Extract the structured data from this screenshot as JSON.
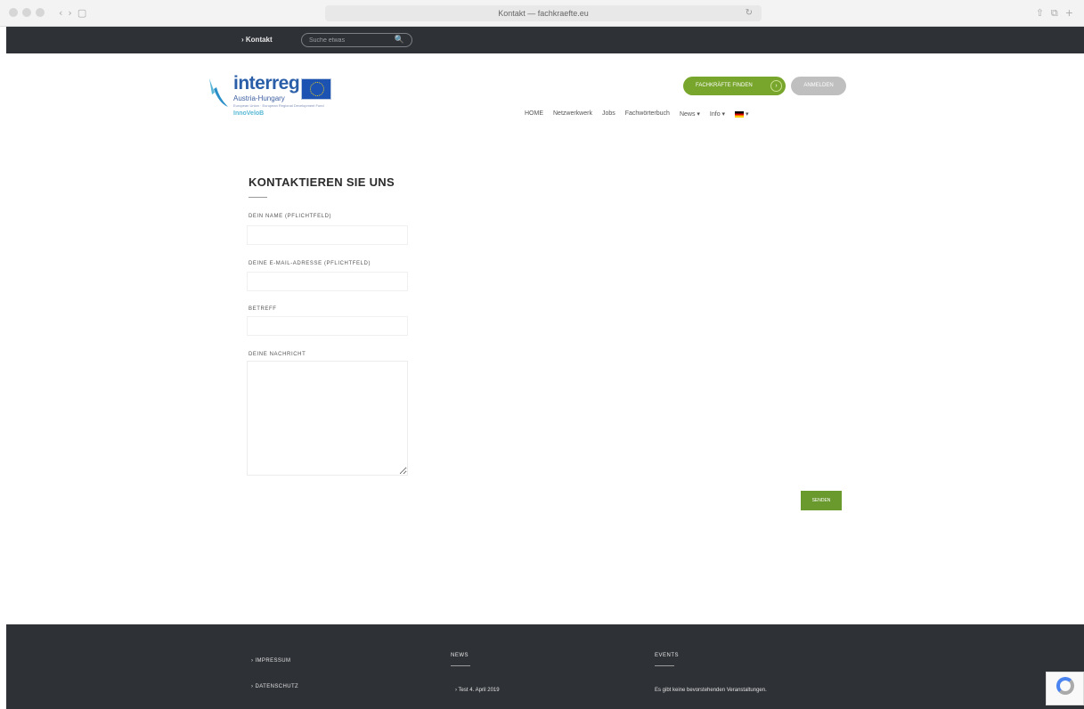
{
  "browser": {
    "address": "Kontakt — fachkraefte.eu",
    "nav_back": "‹",
    "nav_forward": "›",
    "sidebar_icon": "▢",
    "reload_icon": "↻",
    "share_icon": "⇧",
    "tabs_icon": "⧉",
    "newtab_icon": "+"
  },
  "topbar": {
    "kontakt": "› Kontakt",
    "search_placeholder": "Suche etwas",
    "search_icon": "🔍"
  },
  "logo": {
    "word": "interreg",
    "sub": "Austria-Hungary",
    "tiny": "European Union · European Regional Development Fund",
    "project": "InnoVeloB"
  },
  "header": {
    "green_button": "FACHKRÄFTE FINDEN",
    "green_arrow": "›",
    "grey_button": "ANMELDEN"
  },
  "nav": {
    "items": [
      "HOME",
      "Netzwerkwerk",
      "Jobs",
      "Fachwörterbuch",
      "News ▾",
      "Info ▾"
    ],
    "lang_caret": "▾"
  },
  "form": {
    "title": "KONTAKTIEREN SIE UNS",
    "name_label": "DEIN NAME (PFLICHTFELD)",
    "email_label": "DEINE E-MAIL-ADRESSE (PFLICHTFELD)",
    "subject_label": "BETREFF",
    "message_label": "DEINE NACHRICHT",
    "send": "SENDEN"
  },
  "footer": {
    "links": [
      "› IMPRESSUM",
      "› DATENSCHUTZ"
    ],
    "news_heading": "NEWS",
    "news_item": "› Test 4. April 2019",
    "events_heading": "EVENTS",
    "events_text": "Es gibt keine bevorstehenden Veranstaltungen."
  },
  "colors": {
    "topbar": "#2e3136",
    "accent_green": "#78a62c",
    "footer": "#2e3136"
  }
}
